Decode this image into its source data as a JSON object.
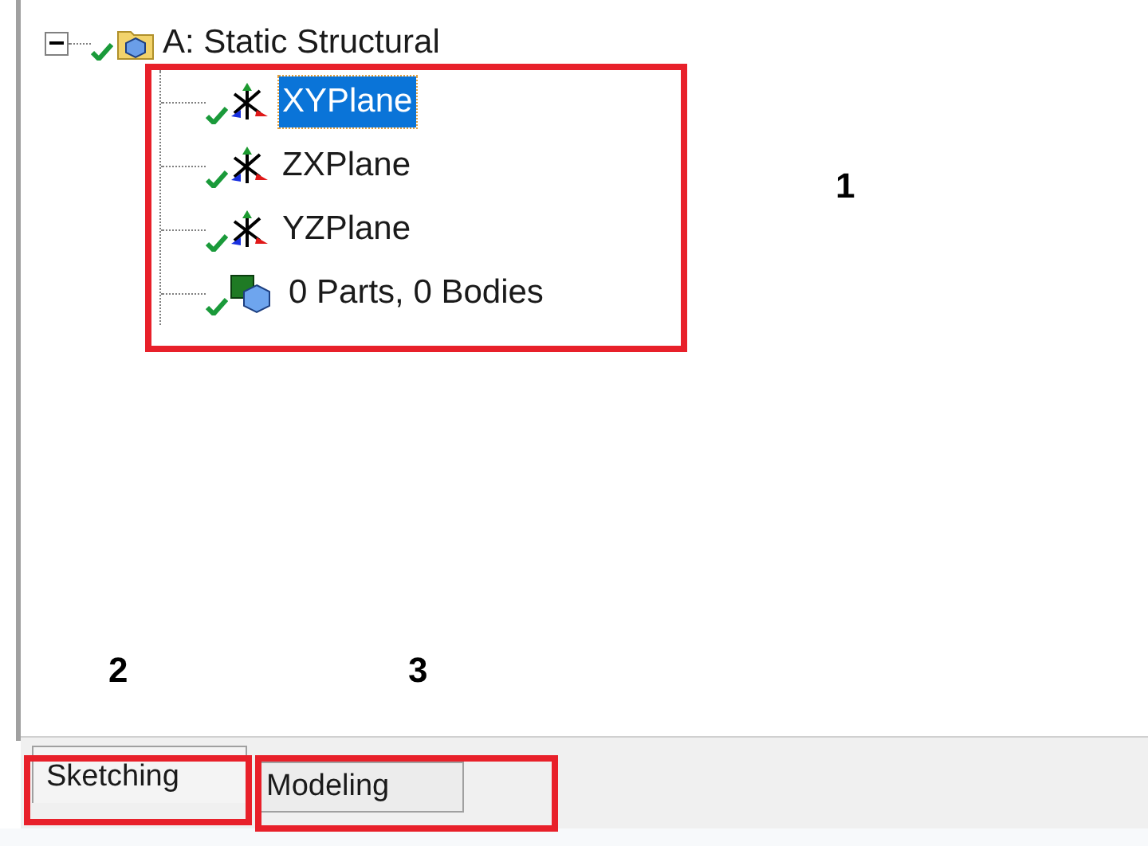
{
  "tree": {
    "label": "A: Static Structural",
    "expanded": true,
    "checked": true,
    "children": [
      {
        "label": "XYPlane",
        "kind": "plane",
        "selected": true,
        "checked": true
      },
      {
        "label": "ZXPlane",
        "kind": "plane",
        "selected": false,
        "checked": true
      },
      {
        "label": "YZPlane",
        "kind": "plane",
        "selected": false,
        "checked": true
      },
      {
        "label": "0 Parts, 0 Bodies",
        "kind": "parts",
        "selected": false,
        "checked": true
      }
    ]
  },
  "tabs": [
    {
      "label": "Sketching",
      "selected": true
    },
    {
      "label": "Modeling",
      "selected": false
    }
  ],
  "callouts": [
    {
      "label": "1"
    },
    {
      "label": "2"
    },
    {
      "label": "3"
    }
  ]
}
